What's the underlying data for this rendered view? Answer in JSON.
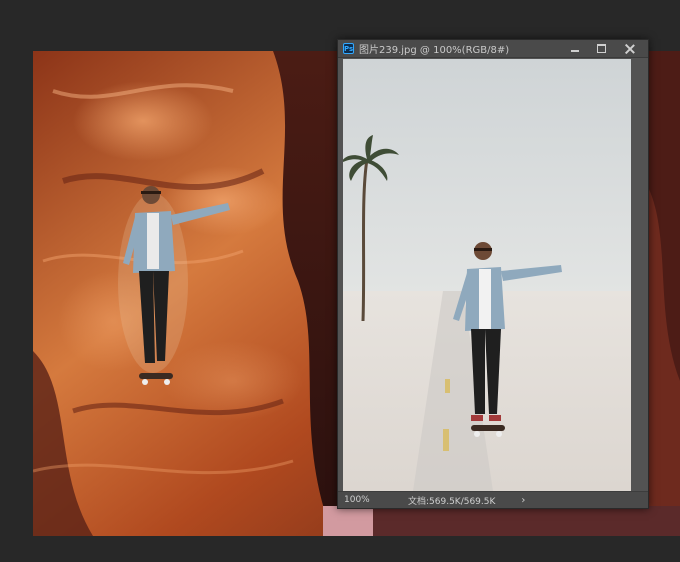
{
  "window": {
    "app_icon": "Ps",
    "title": "图片239.jpg @ 100%(RGB/8#)"
  },
  "statusbar": {
    "zoom": "100%",
    "doc_info": "文档:569.5K/569.5K",
    "arrow": "›"
  },
  "icons": {
    "minimize": "minimize-icon",
    "maximize": "maximize-icon",
    "close": "close-icon",
    "app": "photoshop-icon"
  },
  "colors": {
    "workspace": "#282828",
    "window_chrome": "#535353",
    "accent": "#31a8ff"
  }
}
